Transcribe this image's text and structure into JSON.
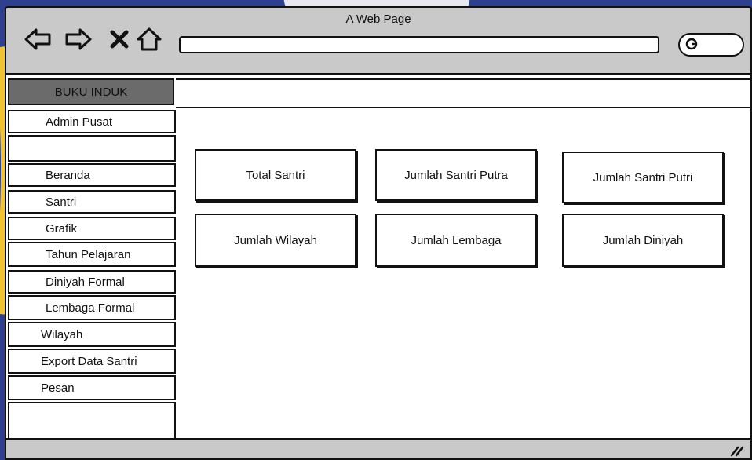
{
  "window": {
    "title": "A Web Page"
  },
  "browser": {
    "back_icon": "arrow-left-icon",
    "forward_icon": "arrow-right-icon",
    "stop_icon": "close-icon",
    "home_icon": "home-icon",
    "url": "",
    "search_icon": "search-icon"
  },
  "sidebar": {
    "header": "BUKU INDUK",
    "user": "Admin Pusat",
    "items": [
      {
        "label": "Beranda"
      },
      {
        "label": "Santri"
      },
      {
        "label": "Grafik"
      },
      {
        "label": "Tahun Pelajaran"
      },
      {
        "label": "Diniyah Formal"
      },
      {
        "label": "Lembaga Formal"
      },
      {
        "label": "Wilayah"
      },
      {
        "label": "Export Data Santri"
      },
      {
        "label": "Pesan"
      }
    ]
  },
  "cards": [
    {
      "label": "Total Santri"
    },
    {
      "label": "Jumlah Santri Putra"
    },
    {
      "label": "Jumlah Santri Putri"
    },
    {
      "label": "Jumlah Wilayah"
    },
    {
      "label": "Jumlah Lembaga"
    },
    {
      "label": "Jumlah Diniyah"
    }
  ],
  "colors": {
    "chrome": "#c9c9c9",
    "sidebar_header": "#6b6b6b",
    "background": "#2e3f8f",
    "accent": "#f2c230"
  }
}
